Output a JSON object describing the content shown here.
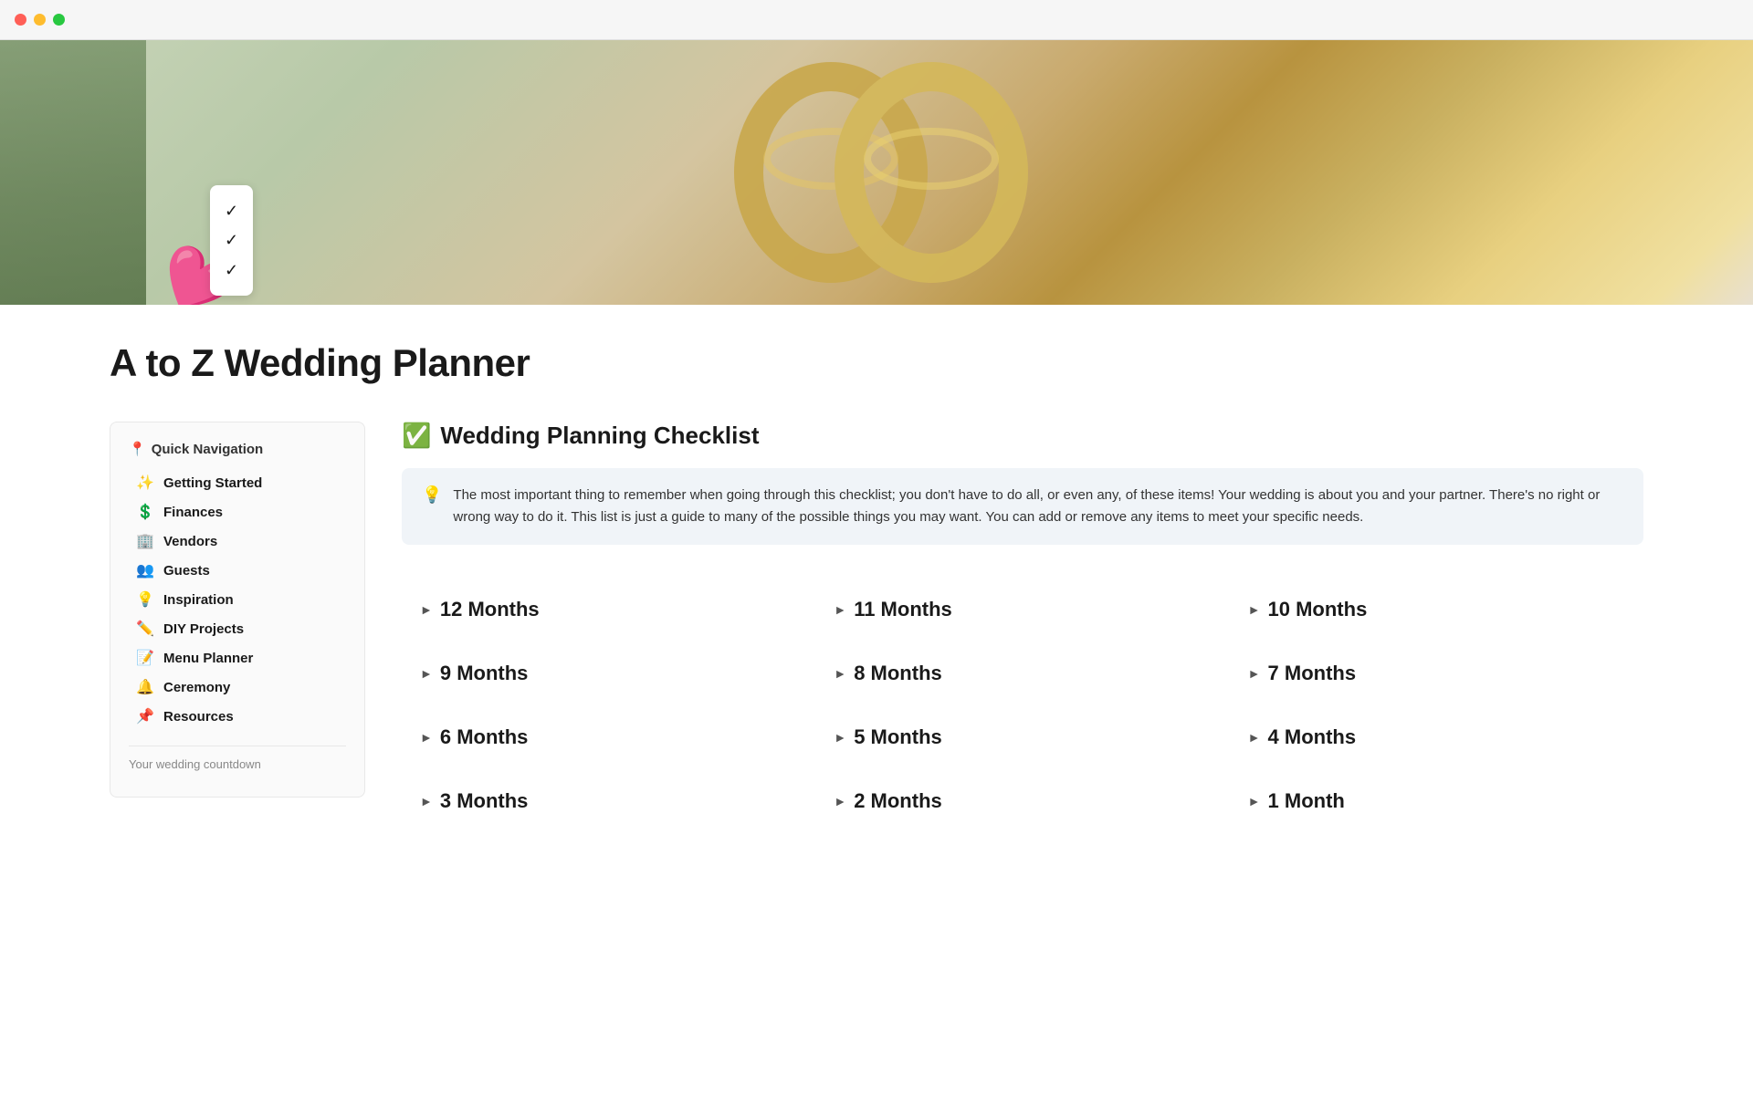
{
  "window": {
    "traffic_close": "close",
    "traffic_minimize": "minimize",
    "traffic_maximize": "maximize"
  },
  "hero": {
    "emoji": "💍",
    "checklist_lines": [
      "✓",
      "✓",
      "✓"
    ]
  },
  "page": {
    "title": "A to Z Wedding Planner"
  },
  "sidebar": {
    "navigation_label": "Quick Navigation",
    "navigation_icon": "📍",
    "items": [
      {
        "emoji": "✨",
        "label": "Getting Started"
      },
      {
        "emoji": "💲",
        "label": "Finances"
      },
      {
        "emoji": "🏢",
        "label": "Vendors"
      },
      {
        "emoji": "👥",
        "label": "Guests"
      },
      {
        "emoji": "💡",
        "label": "Inspiration"
      },
      {
        "emoji": "✏️",
        "label": "DIY Projects"
      },
      {
        "emoji": "📝",
        "label": "Menu Planner"
      },
      {
        "emoji": "🔔",
        "label": "Ceremony"
      },
      {
        "emoji": "📌",
        "label": "Resources"
      }
    ],
    "countdown": {
      "label": "Your wedding countdown"
    }
  },
  "checklist": {
    "title_emoji": "✅",
    "title": "Wedding Planning Checklist",
    "info_icon": "💡",
    "info_text": "The most important thing to remember when going through this checklist; you don't have to do all, or even any, of these items! Your wedding is about you and your partner. There's no right or wrong way to do it. This list is just a guide to many of the possible things you may want. You can add or remove any items to meet your specific needs.",
    "months": [
      {
        "label": "12 Months"
      },
      {
        "label": "11 Months"
      },
      {
        "label": "10 Months"
      },
      {
        "label": "9 Months"
      },
      {
        "label": "8 Months"
      },
      {
        "label": "7 Months"
      },
      {
        "label": "6 Months"
      },
      {
        "label": "5 Months"
      },
      {
        "label": "4 Months"
      },
      {
        "label": "3 Months"
      },
      {
        "label": "2 Months"
      },
      {
        "label": "1 Month"
      }
    ]
  }
}
